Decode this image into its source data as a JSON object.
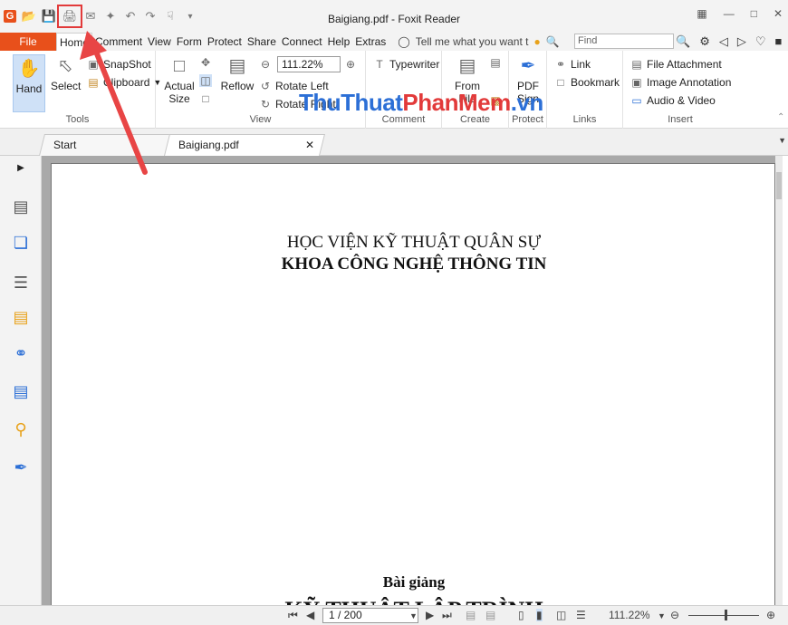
{
  "window": {
    "title": "Baigiang.pdf - Foxit Reader",
    "logo": "G"
  },
  "qat": {
    "icons": [
      "open-icon",
      "save-icon",
      "print-icon",
      "email-icon",
      "new-icon",
      "undo-icon",
      "redo-icon",
      "hand-tool-icon",
      "customize-icon"
    ],
    "highlight": "print-icon"
  },
  "menu": {
    "file": "File",
    "tabs": [
      "Home",
      "Comment",
      "View",
      "Form",
      "Protect",
      "Share",
      "Connect",
      "Help",
      "Extras"
    ],
    "active_tab": "Home",
    "tell_me": "Tell me what you want t",
    "find_placeholder": "Find"
  },
  "ribbon": {
    "tools": {
      "label": "Tools",
      "hand": "Hand",
      "select": "Select",
      "snapshot": "SnapShot",
      "clipboard": "Clipboard"
    },
    "view": {
      "label": "View",
      "actual": "Actual",
      "size": "Size",
      "reflow": "Reflow",
      "zoom": "111.22%",
      "rotate_left": "Rotate Left",
      "rotate_right": "Rotate Right"
    },
    "comment": {
      "label": "Comment",
      "typewriter": "Typewriter"
    },
    "create": {
      "label": "Create",
      "from": "From",
      "file": "File"
    },
    "protect": {
      "label": "Protect",
      "pdf": "PDF",
      "sign": "Sign"
    },
    "links": {
      "label": "Links",
      "link": "Link",
      "bookmark": "Bookmark"
    },
    "insert": {
      "label": "Insert",
      "file_attachment": "File Attachment",
      "image_annotation": "Image Annotation",
      "audio_video": "Audio & Video"
    }
  },
  "watermark": {
    "part1": "ThuThuat",
    "part2": "PhanMem",
    "part3": ".vn"
  },
  "doc_tabs": [
    {
      "label": "Start"
    },
    {
      "label": "Baigiang.pdf"
    }
  ],
  "document": {
    "line1": "HỌC VIỆN KỸ THUẬT QUÂN SỰ",
    "line2": "KHOA CÔNG NGHỆ THÔNG TIN",
    "line3": "Bài giảng",
    "line4": "KỸ THUẬT LẬP TRÌNH"
  },
  "status": {
    "page": "1 / 200",
    "zoom": "111.22%"
  },
  "colors": {
    "accent": "#e8501b",
    "highlight": "#e23a3a"
  }
}
